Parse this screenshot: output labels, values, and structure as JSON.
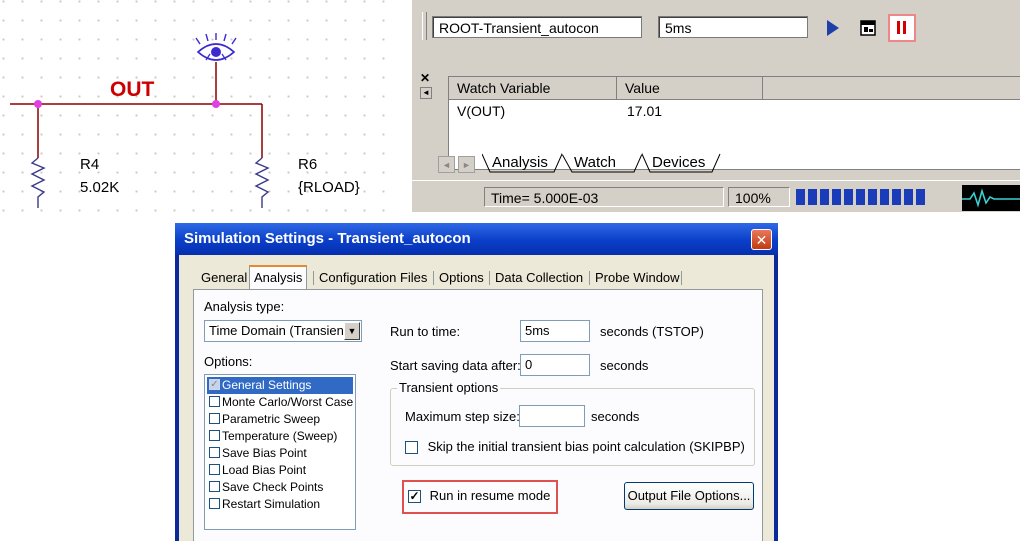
{
  "schematic": {
    "net_label": "OUT",
    "parts": [
      {
        "ref": "R4",
        "value": "5.02K"
      },
      {
        "ref": "R6",
        "value": "{RLOAD}"
      }
    ],
    "colors": {
      "wire": "#8b0000",
      "junction": "#e040e0",
      "net_label": "#cc0000",
      "probe": "#3a2ad0"
    }
  },
  "toolbar": {
    "profile": "ROOT-Transient_autocon",
    "run_time": "5ms"
  },
  "watch": {
    "dock_glyph": "✕",
    "columns": [
      "Watch Variable",
      "Value"
    ],
    "rows": [
      {
        "variable": "V(OUT)",
        "value": "17.01"
      }
    ],
    "tabs": [
      "Analysis",
      "Watch",
      "Devices"
    ]
  },
  "status": {
    "time": "Time= 5.000E-03",
    "percent": "100%",
    "progress_fraction": 1.0
  },
  "dialog": {
    "title": "Simulation Settings - Transient_autocon",
    "close_glyph": "✕",
    "tabs": [
      "General",
      "Analysis",
      "Configuration Files",
      "Options",
      "Data Collection",
      "Probe Window"
    ],
    "active_tab": "Analysis",
    "analysis_type_label": "Analysis type:",
    "analysis_type_value": "Time Domain (Transient)",
    "options_label": "Options:",
    "options": [
      {
        "label": "General Settings",
        "checked": true,
        "selected": true
      },
      {
        "label": "Monte Carlo/Worst Case",
        "checked": false
      },
      {
        "label": "Parametric Sweep",
        "checked": false
      },
      {
        "label": "Temperature (Sweep)",
        "checked": false
      },
      {
        "label": "Save Bias Point",
        "checked": false
      },
      {
        "label": "Load Bias Point",
        "checked": false
      },
      {
        "label": "Save Check Points",
        "checked": false
      },
      {
        "label": "Restart Simulation",
        "checked": false
      }
    ],
    "run_to_time_label": "Run to time:",
    "run_to_time_value": "5ms",
    "run_to_time_unit": "seconds  (TSTOP)",
    "start_saving_label": "Start saving data after:",
    "start_saving_value": "0",
    "start_saving_unit": "seconds",
    "transient_group": "Transient options",
    "max_step_label": "Maximum step size:",
    "max_step_value": "",
    "max_step_unit": "seconds",
    "skipbp_label": "Skip the initial transient bias point calculation  (SKIPBP)",
    "skipbp_checked": false,
    "resume_label": "Run in resume mode",
    "resume_checked": true,
    "output_button": "Output File Options..."
  }
}
